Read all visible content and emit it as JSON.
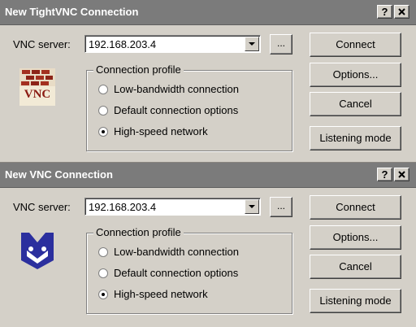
{
  "colors": {
    "dialog_bg": "#d4d0c8",
    "titlebar_bg": "#7b7b7b",
    "title_text": "#ffffff",
    "tight_logo_red": "#a33020",
    "vnc_logo_blue": "#2b2f9e"
  },
  "dialogs": [
    {
      "title": "New TightVNC Connection",
      "help_symbol": "?",
      "server_label": "VNC server:",
      "server_value": "192.168.203.4",
      "browse_label": "...",
      "profile_title": "Connection profile",
      "profile_options": [
        {
          "label": "Low-bandwidth connection",
          "selected": false
        },
        {
          "label": "Default connection options",
          "selected": false
        },
        {
          "label": "High-speed network",
          "selected": true
        }
      ],
      "buttons": [
        "Connect",
        "Options...",
        "Cancel",
        "Listening mode"
      ],
      "logo": {
        "name": "tightvnc-logo-icon",
        "text": "VNC"
      }
    },
    {
      "title": "New VNC Connection",
      "help_symbol": "?",
      "server_label": "VNC server:",
      "server_value": "192.168.203.4",
      "browse_label": "...",
      "profile_title": "Connection profile",
      "profile_options": [
        {
          "label": "Low-bandwidth connection",
          "selected": false
        },
        {
          "label": "Default connection options",
          "selected": false
        },
        {
          "label": "High-speed network",
          "selected": true
        }
      ],
      "buttons": [
        "Connect",
        "Options...",
        "Cancel",
        "Listening mode"
      ],
      "logo": {
        "name": "realvnc-logo-icon"
      }
    }
  ]
}
